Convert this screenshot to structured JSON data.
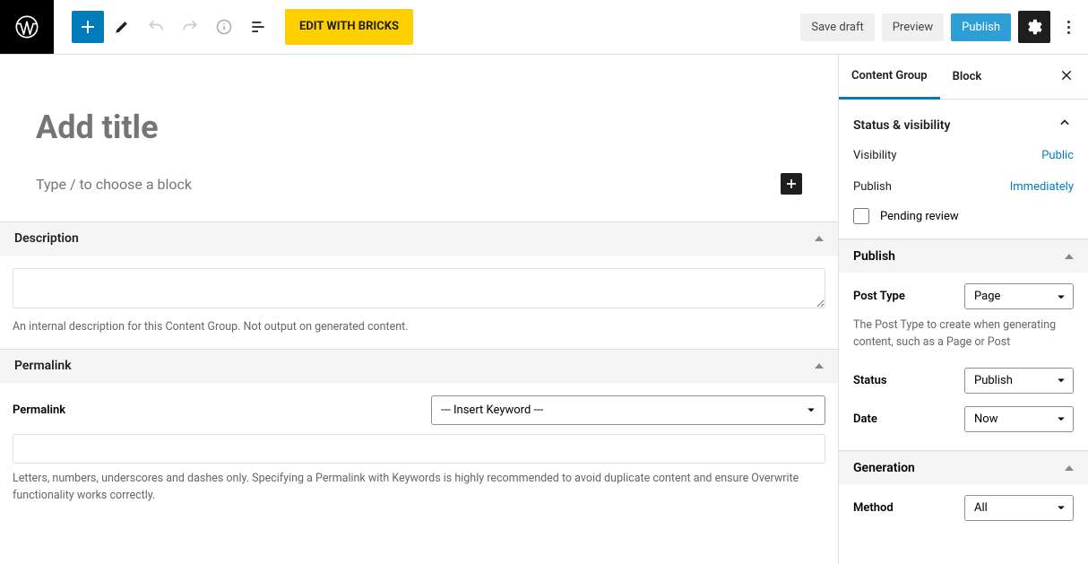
{
  "topbar": {
    "edit_bricks": "EDIT WITH BRICKS",
    "save_draft": "Save draft",
    "preview": "Preview",
    "publish": "Publish"
  },
  "editor": {
    "title_placeholder": "Add title",
    "block_placeholder": "Type / to choose a block"
  },
  "panels": {
    "description": {
      "title": "Description",
      "hint": "An internal description for this Content Group. Not output on generated content."
    },
    "permalink": {
      "title": "Permalink",
      "label": "Permalink",
      "select": "--- Insert Keyword ---",
      "hint": "Letters, numbers, underscores and dashes only. Specifying a Permalink with Keywords is highly recommended to avoid duplicate content and ensure Overwrite functionality works correctly."
    }
  },
  "sidebar": {
    "tabs": {
      "content_group": "Content Group",
      "block": "Block"
    },
    "status_visibility": {
      "title": "Status & visibility",
      "visibility_label": "Visibility",
      "visibility_value": "Public",
      "publish_label": "Publish",
      "publish_value": "Immediately",
      "pending_review": "Pending review"
    },
    "publish_panel": {
      "title": "Publish",
      "post_type_label": "Post Type",
      "post_type_value": "Page",
      "post_type_desc": "The Post Type to create when generating content, such as a Page or Post",
      "status_label": "Status",
      "status_value": "Publish",
      "date_label": "Date",
      "date_value": "Now"
    },
    "generation": {
      "title": "Generation",
      "method_label": "Method",
      "method_value": "All"
    }
  }
}
